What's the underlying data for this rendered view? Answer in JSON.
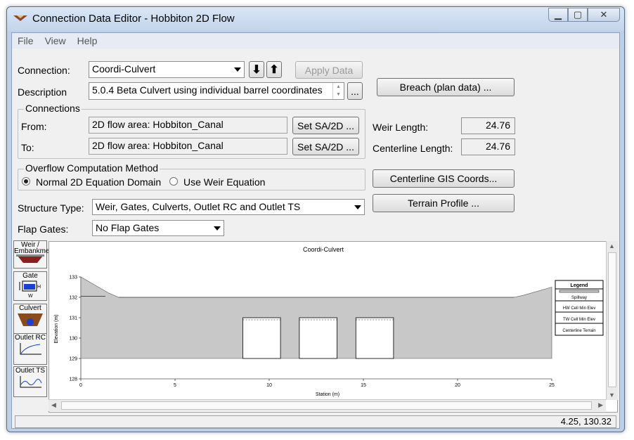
{
  "window": {
    "title": "Connection Data Editor - Hobbiton 2D Flow"
  },
  "menu": [
    "File",
    "View",
    "Help"
  ],
  "connection": {
    "label": "Connection:",
    "value": "Coordi-Culvert"
  },
  "apply_button": "Apply Data",
  "description": {
    "label": "Description",
    "value": "5.0.4 Beta Culvert using individual barrel coordinates",
    "more": "..."
  },
  "breach_button": "Breach (plan data) ...",
  "connections": {
    "title": "Connections",
    "from_label": "From:",
    "from_value": "2D flow area: Hobbiton_Canal",
    "to_label": "To:",
    "to_value": "2D flow area: Hobbiton_Canal",
    "set_button": "Set SA/2D ..."
  },
  "weir_length": {
    "label": "Weir Length:",
    "value": "24.76"
  },
  "centerline_length": {
    "label": "Centerline Length:",
    "value": "24.76"
  },
  "overflow": {
    "title": "Overflow Computation Method",
    "options": [
      "Normal 2D Equation Domain",
      "Use Weir Equation"
    ],
    "selected": "Normal 2D Equation Domain"
  },
  "gis_button": "Centerline GIS Coords...",
  "terrain_button": "Terrain Profile ...",
  "structure_type": {
    "label": "Structure Type:",
    "value": "Weir, Gates, Culverts, Outlet RC and Outlet TS"
  },
  "flap_gates": {
    "label": "Flap Gates:",
    "value": "No Flap Gates"
  },
  "side_tools": [
    {
      "label": "Weir / Embankment",
      "icon": "embankment-icon"
    },
    {
      "label": "Gate",
      "icon": "gate-icon"
    },
    {
      "label": "Culvert",
      "icon": "culvert-icon"
    },
    {
      "label": "Outlet RC",
      "icon": "rating-curve-icon"
    },
    {
      "label": "Outlet TS",
      "icon": "time-series-icon"
    }
  ],
  "status": {
    "coords": "4.25, 130.32"
  },
  "chart_data": {
    "type": "area",
    "title": "Coordi-Culvert",
    "xlabel": "Station (m)",
    "ylabel": "Elevation (m)",
    "xlim": [
      0,
      25
    ],
    "ylim": [
      128,
      133
    ],
    "xticks": [
      0,
      5,
      10,
      15,
      20,
      25
    ],
    "yticks": [
      128,
      129,
      130,
      131,
      132,
      133
    ],
    "embankment": {
      "top": 132,
      "bottom": 129,
      "profile": [
        [
          0,
          133
        ],
        [
          1.5,
          132.2
        ],
        [
          2,
          132
        ],
        [
          23,
          132
        ],
        [
          23.5,
          132.1
        ],
        [
          25,
          132.5
        ]
      ]
    },
    "culverts": [
      {
        "x_left": 8.6,
        "x_right": 10.6,
        "invert": 129,
        "crown": 131
      },
      {
        "x_left": 11.6,
        "x_right": 13.6,
        "invert": 129,
        "crown": 131
      },
      {
        "x_left": 14.6,
        "x_right": 16.6,
        "invert": 129,
        "crown": 131
      }
    ],
    "legend": {
      "title": "Legend",
      "entries": [
        "Spillway",
        "HW Cell Min Elev",
        "TW Cell Min Elev",
        "Centerline Terrain"
      ]
    }
  }
}
